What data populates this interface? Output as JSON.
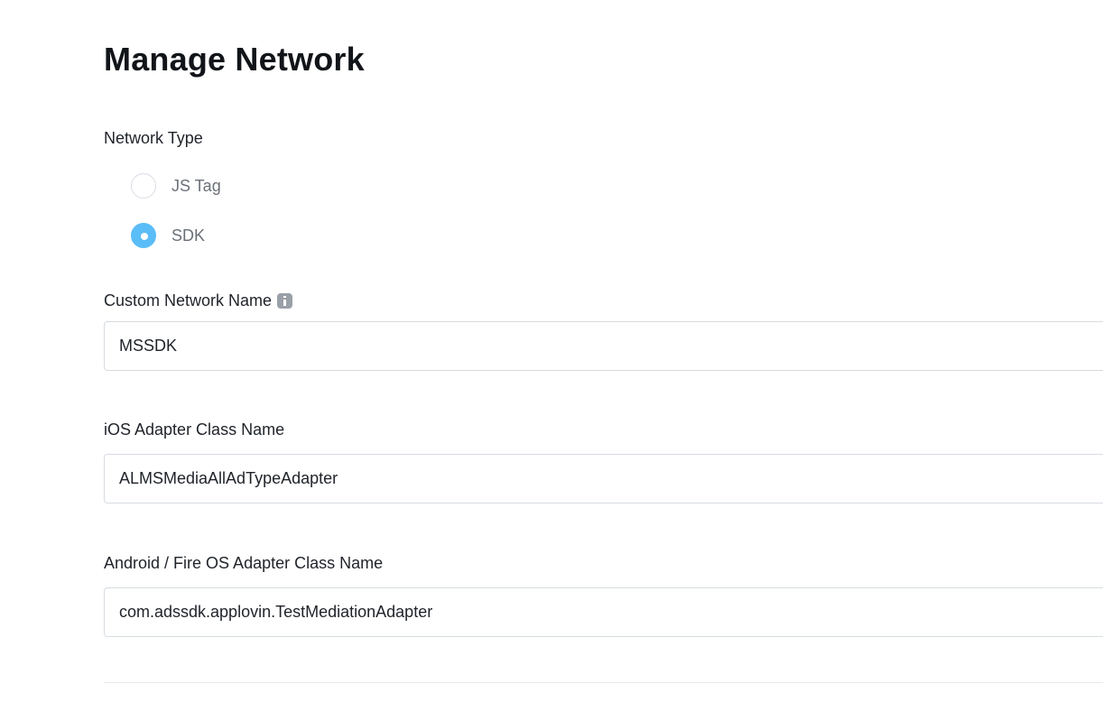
{
  "page": {
    "title": "Manage Network"
  },
  "network_type": {
    "label": "Network Type",
    "options": [
      {
        "label": "JS Tag",
        "selected": false
      },
      {
        "label": "SDK",
        "selected": true
      }
    ]
  },
  "custom_network_name": {
    "label": "Custom Network Name",
    "info_icon": "info-icon",
    "value": "MSSDK"
  },
  "ios_adapter": {
    "label": "iOS Adapter Class Name",
    "value": "ALMSMediaAllAdTypeAdapter"
  },
  "android_adapter": {
    "label": "Android / Fire OS Adapter Class Name",
    "value": "com.adssdk.applovin.TestMediationAdapter"
  },
  "colors": {
    "accent": "#5bbdf7",
    "input_border": "#d7dbe0",
    "muted_text": "#6b7078"
  }
}
